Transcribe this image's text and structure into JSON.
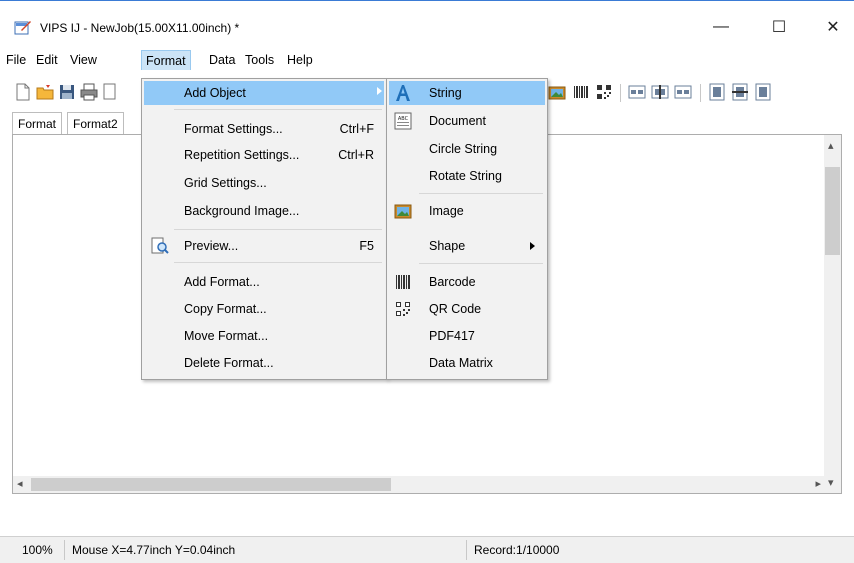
{
  "window": {
    "title": "VIPS IJ - NewJob(15.00X11.00inch) *",
    "minimize_glyph": "—",
    "maximize_glyph": "☐",
    "close_glyph": "✕"
  },
  "menubar": {
    "items": [
      "File",
      "Edit",
      "View",
      "Format",
      "Data",
      "Tools",
      "Help"
    ],
    "open_item": "Format"
  },
  "tabs": [
    "Format",
    "Format2"
  ],
  "format_menu": {
    "items": [
      {
        "label": "Add Object",
        "shortcut": "",
        "submenu": true,
        "highlighted": true
      },
      {
        "label": "Format Settings...",
        "shortcut": "Ctrl+F"
      },
      {
        "label": "Repetition Settings...",
        "shortcut": "Ctrl+R"
      },
      {
        "label": "Grid Settings...",
        "shortcut": ""
      },
      {
        "label": "Background Image...",
        "shortcut": ""
      },
      {
        "label": "Preview...",
        "shortcut": "F5",
        "icon": "preview-magnifier-icon"
      },
      {
        "label": "Add Format...",
        "shortcut": ""
      },
      {
        "label": "Copy Format...",
        "shortcut": ""
      },
      {
        "label": "Move Format...",
        "shortcut": ""
      },
      {
        "label": "Delete Format...",
        "shortcut": ""
      }
    ]
  },
  "add_object_submenu": {
    "items": [
      {
        "label": "String",
        "icon": "string-a-icon",
        "highlighted": true
      },
      {
        "label": "Document",
        "icon": "document-abc-icon"
      },
      {
        "label": "Circle String"
      },
      {
        "label": "Rotate String"
      },
      {
        "label": "Image",
        "icon": "image-icon"
      },
      {
        "label": "Shape",
        "submenu": true
      },
      {
        "label": "Barcode",
        "icon": "barcode-icon"
      },
      {
        "label": "QR Code",
        "icon": "qr-code-icon"
      },
      {
        "label": "PDF417"
      },
      {
        "label": "Data Matrix"
      }
    ]
  },
  "status": {
    "zoom": "100%",
    "mouse": "Mouse X=4.77inch Y=0.04inch",
    "record": "Record:1/10000"
  },
  "colors": {
    "menu_highlight": "#91c9f7",
    "menubar_open": "#cce4f7",
    "menu_bg": "#f2f2f2"
  }
}
